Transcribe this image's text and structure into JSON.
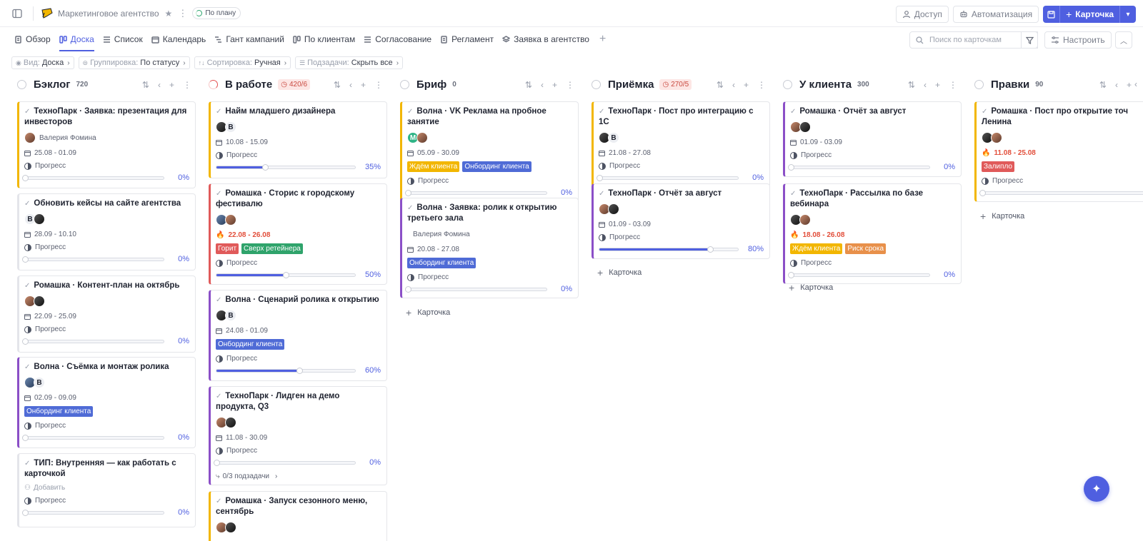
{
  "header": {
    "project_name": "Маркетинговое агентство",
    "status": "По плану",
    "access_label": "Доступ",
    "automation_label": "Автоматизация",
    "card_label": "Карточка"
  },
  "tabs": [
    {
      "label": "Обзор",
      "icon": "doc-icon"
    },
    {
      "label": "Доска",
      "icon": "board-icon",
      "active": true
    },
    {
      "label": "Список",
      "icon": "list-icon"
    },
    {
      "label": "Календарь",
      "icon": "calendar-icon"
    },
    {
      "label": "Гант кампаний",
      "icon": "gantt-icon"
    },
    {
      "label": "По клиентам",
      "icon": "board-icon"
    },
    {
      "label": "Согласование",
      "icon": "list-icon"
    },
    {
      "label": "Регламент",
      "icon": "doc-icon"
    },
    {
      "label": "Заявка в агентство",
      "icon": "layers-icon"
    }
  ],
  "search": {
    "placeholder": "Поиск по карточкам"
  },
  "configure_label": "Настроить",
  "filters": [
    {
      "label": "Вид:",
      "value": "Доска"
    },
    {
      "label": "Группировка:",
      "value": "По статусу"
    },
    {
      "label": "Сортировка:",
      "value": "Ручная"
    },
    {
      "label": "Подзадачи:",
      "value": "Скрыть все"
    }
  ],
  "progress_label": "Прогресс",
  "add_card_label": "Карточка",
  "add_person_label": "Добавить",
  "columns": [
    {
      "title": "Бэклог",
      "count": "720",
      "cards": [
        {
          "title": "ТехноПарк · Заявка: презентация для инвесторов",
          "person": "Валерия Фомина",
          "date": "25.08 - 01.09",
          "progress": "0%"
        },
        {
          "title": "Обновить кейсы на сайте агентства",
          "date": "28.09 - 10.10",
          "progress": "0%"
        },
        {
          "title": "Ромашка · Контент-план на октябрь",
          "date": "22.09 - 25.09",
          "progress": "0%"
        },
        {
          "title": "Волна · Съёмка и монтаж ролика",
          "date": "02.09 - 09.09",
          "tags": [
            "Онбординг клиента"
          ],
          "progress": "0%"
        },
        {
          "title": "ТИП: Внутренняя — как работать с карточкой",
          "progress": "0%"
        }
      ]
    },
    {
      "title": "В работе",
      "badge": "420/6",
      "cards": [
        {
          "title": "Найм младшего дизайнера",
          "date": "10.08 - 15.09",
          "progress": "35%"
        },
        {
          "title": "Ромашка · Сторис к городскому фестивалю",
          "date": "22.08 - 26.08",
          "tags": [
            "Горит",
            "Сверх ретейнера"
          ],
          "progress": "50%"
        },
        {
          "title": "Волна · Сценарий ролика к открытию",
          "date": "24.08 - 01.09",
          "tags": [
            "Онбординг клиента"
          ],
          "progress": "60%"
        },
        {
          "title": "ТехноПарк · Лидген на демо продукта, Q3",
          "date": "11.08 - 30.09",
          "progress": "0%",
          "subtasks": "0/3 подзадачи"
        },
        {
          "title": "Ромашка · Запуск сезонного меню, сентябрь"
        }
      ]
    },
    {
      "title": "Бриф",
      "count": "0",
      "cards": [
        {
          "title": "Волна · VK Реклама на пробное занятие",
          "date": "05.09 - 30.09",
          "tags": [
            "Ждём клиента",
            "Онбординг клиента"
          ],
          "progress": "0%"
        },
        {
          "title": "Волна · Заявка: ролик к открытию третьего зала",
          "person": "Валерия Фомина",
          "date": "20.08 - 27.08",
          "tags": [
            "Онбординг клиента"
          ],
          "progress": "0%"
        }
      ]
    },
    {
      "title": "Приёмка",
      "badge": "270/5",
      "cards": [
        {
          "title": "ТехноПарк · Пост про интеграцию с 1С",
          "date": "21.08 - 27.08",
          "progress": "0%"
        },
        {
          "title": "ТехноПарк · Отчёт за август",
          "date": "01.09 - 03.09",
          "progress": "80%"
        }
      ]
    },
    {
      "title": "У клиента",
      "count": "300",
      "cards": [
        {
          "title": "Ромашка · Отчёт за август",
          "date": "01.09 - 03.09",
          "progress": "0%"
        },
        {
          "title": "ТехноПарк · Рассылка по базе вебинара",
          "date": "18.08 - 26.08",
          "tags": [
            "Ждём клиента",
            "Риск срока"
          ],
          "progress": "0%"
        }
      ]
    },
    {
      "title": "Правки",
      "count": "90",
      "cards": [
        {
          "title": "Ромашка · Пост про открытие точ Ленина",
          "date": "11.08 - 25.08",
          "tags": [
            "Залипло"
          ]
        }
      ]
    }
  ],
  "colors": {
    "accent": "#4f5fe0",
    "danger": "#e24e3a",
    "tag_blue": "#4f6bd6",
    "tag_yellow": "#f2b600",
    "tag_red": "#e05a5a",
    "tag_green": "#2fa36b",
    "tag_orange": "#e8904a"
  }
}
